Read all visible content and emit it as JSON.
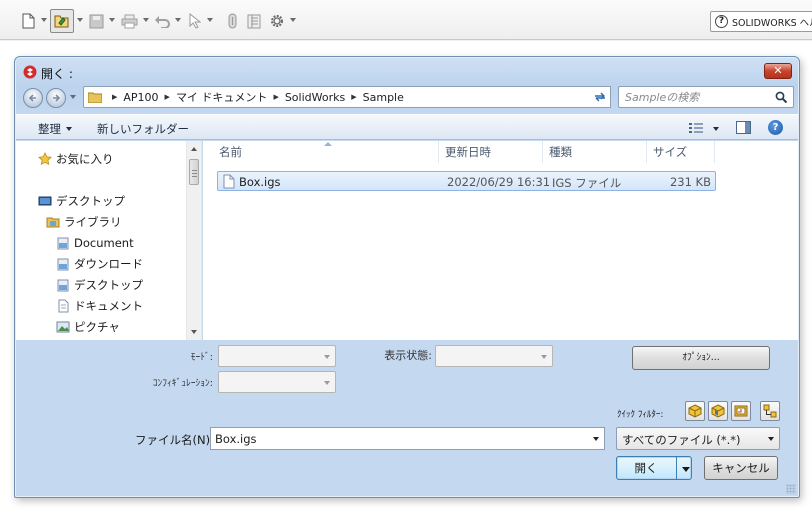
{
  "toolbar": {
    "help_label": "SOLIDWORKS ヘルプ"
  },
  "dialog": {
    "title": "開く :",
    "close_label": "✕",
    "address": {
      "crumbs": [
        "AP100",
        "マイ ドキュメント",
        "SolidWorks",
        "Sample"
      ]
    },
    "search_placeholder": "Sampleの検索",
    "commands": {
      "organize": "整理",
      "new_folder": "新しいフォルダー"
    },
    "nav": {
      "favorites": "お気に入り",
      "desktop": "デスクトップ",
      "libraries": "ライブラリ",
      "document": "Document",
      "downloads": "ダウンロード",
      "desktop2": "デスクトップ",
      "documents": "ドキュメント",
      "pictures": "ピクチャ"
    },
    "columns": {
      "name": "名前",
      "modified": "更新日時",
      "type": "種類",
      "size": "サイズ"
    },
    "files": [
      {
        "name": "Box.igs",
        "modified": "2022/06/29 16:31",
        "type": "IGS ファイル",
        "size": "231 KB"
      }
    ],
    "mode_label": "ﾓｰﾄﾞ:",
    "config_label": "ｺﾝﾌｨｷﾞｭﾚｰｼｮﾝ:",
    "display_state_label": "表示状態:",
    "options_label": "ｵﾌﾟｼｮﾝ...",
    "quick_filter_label": "ｸｲｯｸ ﾌｨﾙﾀｰ:",
    "filename_label": "ファイル名(N):",
    "filename_value": "Box.igs",
    "filter_value": "すべてのファイル (*.*)",
    "open_label": "開く",
    "cancel_label": "キャンセル"
  }
}
